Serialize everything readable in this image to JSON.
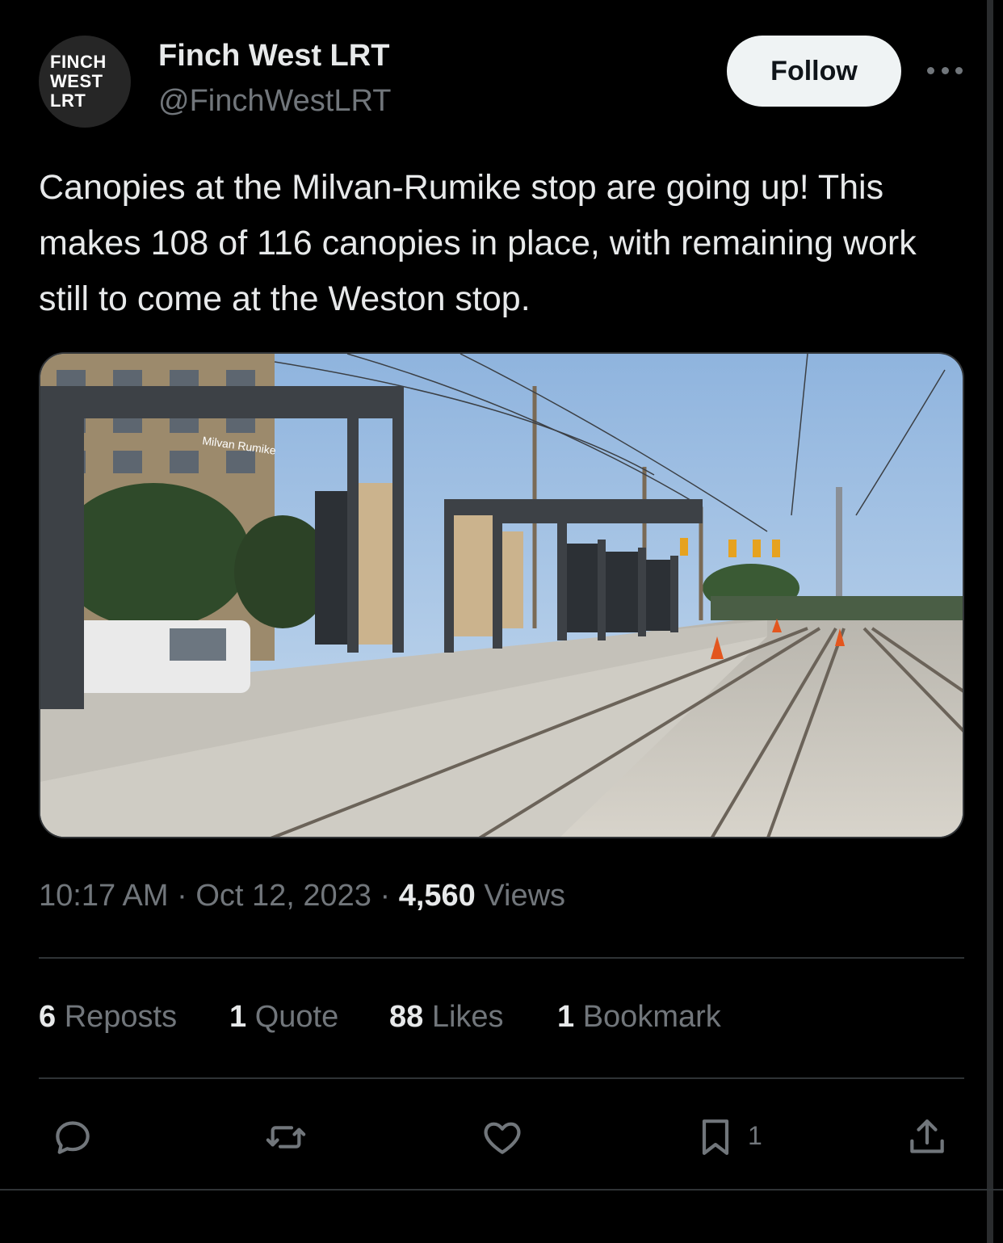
{
  "author": {
    "avatar_lines": [
      "FINCH",
      "WEST",
      "LRT"
    ],
    "display_name": "Finch West LRT",
    "handle": "@FinchWestLRT"
  },
  "follow_label": "Follow",
  "tweet_text": "Canopies at the Milvan-Rumike stop are going up! This makes 108 of 116 canopies in place, with remaining work still to come at the Weston stop.",
  "media": {
    "sign_text": "Milvan Rumike"
  },
  "meta": {
    "time": "10:17 AM",
    "date": "Oct 12, 2023",
    "views_count": "4,560",
    "views_label": "Views"
  },
  "stats": {
    "reposts_count": "6",
    "reposts_label": "Reposts",
    "quotes_count": "1",
    "quotes_label": "Quote",
    "likes_count": "88",
    "likes_label": "Likes",
    "bookmarks_count": "1",
    "bookmarks_label": "Bookmark"
  },
  "actions": {
    "bookmark_count": "1",
    "icons": [
      "reply-icon",
      "repost-icon",
      "like-icon",
      "bookmark-icon",
      "share-icon"
    ]
  },
  "colors": {
    "background": "#000000",
    "text": "#e7e9ea",
    "muted": "#71767b",
    "follow_bg": "#eff3f4"
  }
}
